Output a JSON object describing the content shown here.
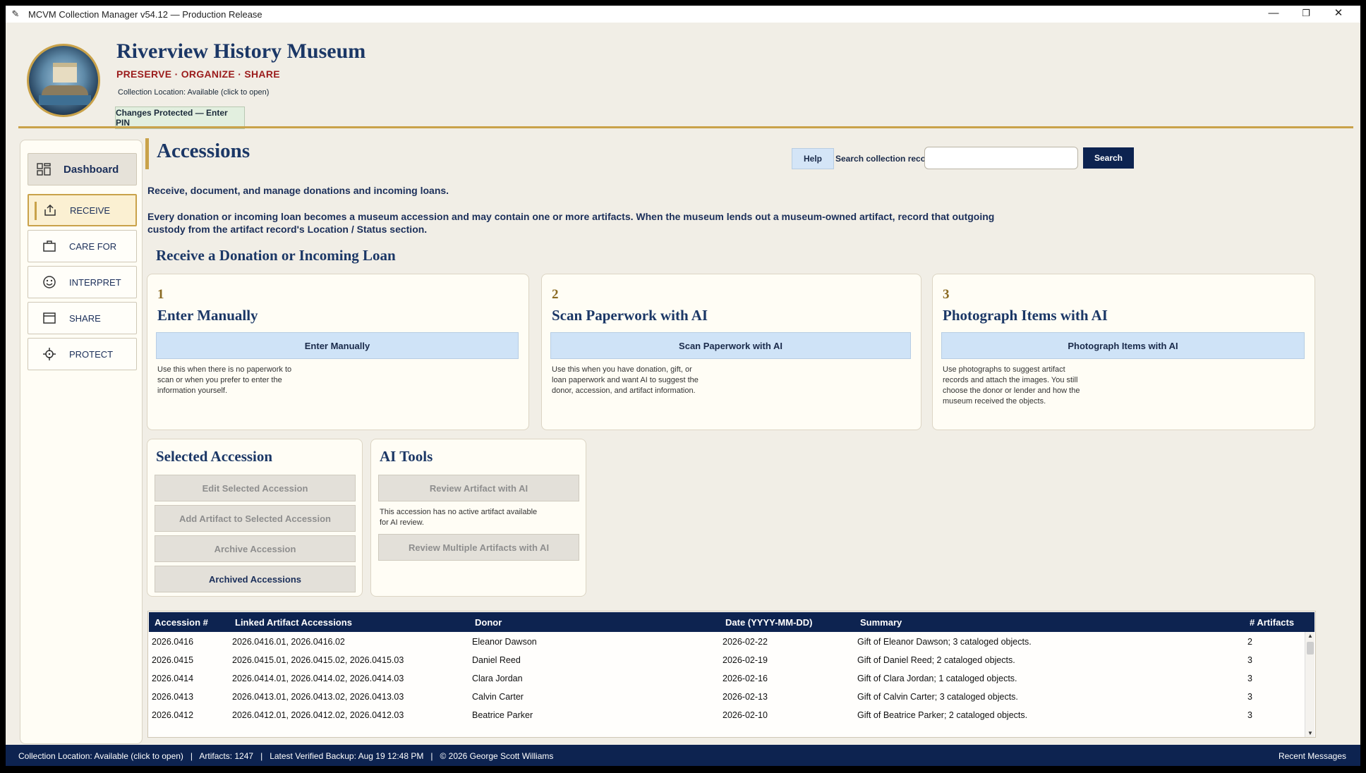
{
  "window": {
    "title": "MCVM Collection Manager v54.12 — Production Release",
    "app_icon": "feather-icon",
    "minimize": "—",
    "restore": "❐",
    "close": "✕"
  },
  "header": {
    "museum_name": "Riverview History Museum",
    "tagline": "PRESERVE · ORGANIZE · SHARE",
    "location": "Collection Location: Available (click to open)",
    "pin_button": "Changes Protected — Enter PIN"
  },
  "sidebar": {
    "dashboard": "Dashboard",
    "items": [
      {
        "label": "RECEIVE",
        "icon": "inbox-upload-icon"
      },
      {
        "label": "CARE FOR",
        "icon": "briefcase-icon"
      },
      {
        "label": "INTERPRET",
        "icon": "smiley-icon"
      },
      {
        "label": "SHARE",
        "icon": "window-icon"
      },
      {
        "label": "PROTECT",
        "icon": "crosshair-icon"
      }
    ]
  },
  "page": {
    "title": "Accessions",
    "help_label": "Help",
    "search_label": "Search collection records",
    "search_placeholder": "",
    "search_value": "",
    "search_button": "Search",
    "subtitle": "Receive, document, and manage donations and incoming loans.",
    "intro": "Every donation or incoming loan becomes a museum accession and may contain one or more artifacts. When the museum lends out a museum-owned artifact, record that outgoing custody from the artifact record's Location / Status section.",
    "receive_heading": "Receive a Donation or Incoming Loan"
  },
  "cards": [
    {
      "number": "1",
      "title": "Enter Manually",
      "button": "Enter Manually",
      "description": "Use this when there is no paperwork to scan or when you prefer to enter the information yourself."
    },
    {
      "number": "2",
      "title": "Scan Paperwork with AI",
      "button": "Scan Paperwork with AI",
      "description": "Use this when you have donation, gift, or loan paperwork and want AI to suggest the donor, accession, and artifact information."
    },
    {
      "number": "3",
      "title": "Photograph Items with AI",
      "button": "Photograph Items with AI",
      "description": "Use photographs to suggest artifact records and attach the images. You still choose the donor or lender and how the museum received the objects."
    }
  ],
  "selected_accession": {
    "title": "Selected Accession",
    "edit": "Edit Selected Accession",
    "add_artifact": "Add Artifact to Selected Accession",
    "archive": "Archive Accession",
    "archived": "Archived Accessions"
  },
  "ai_tools": {
    "title": "AI Tools",
    "review": "Review Artifact with AI",
    "note": "This accession has no active artifact available for AI review.",
    "review_multiple": "Review Multiple Artifacts with AI"
  },
  "table": {
    "columns": [
      "Accession #",
      "Linked Artifact Accessions",
      "Donor",
      "Date (YYYY-MM-DD)",
      "Summary",
      "# Artifacts"
    ],
    "rows": [
      [
        "2026.0416",
        "2026.0416.01, 2026.0416.02",
        "Eleanor Dawson",
        "2026-02-22",
        "Gift of Eleanor Dawson; 3 cataloged objects.",
        "2"
      ],
      [
        "2026.0415",
        "2026.0415.01, 2026.0415.02, 2026.0415.03",
        "Daniel Reed",
        "2026-02-19",
        "Gift of Daniel Reed; 2 cataloged objects.",
        "3"
      ],
      [
        "2026.0414",
        "2026.0414.01, 2026.0414.02, 2026.0414.03",
        "Clara Jordan",
        "2026-02-16",
        "Gift of Clara Jordan; 1 cataloged objects.",
        "3"
      ],
      [
        "2026.0413",
        "2026.0413.01, 2026.0413.02, 2026.0413.03",
        "Calvin Carter",
        "2026-02-13",
        "Gift of Calvin Carter; 3 cataloged objects.",
        "3"
      ],
      [
        "2026.0412",
        "2026.0412.01, 2026.0412.02, 2026.0412.03",
        "Beatrice Parker",
        "2026-02-10",
        "Gift of Beatrice Parker; 2 cataloged objects.",
        "3"
      ]
    ]
  },
  "statusbar": {
    "text": "Collection Location: Available (click to open)   |   Artifacts: 1247   |   Latest Verified Backup: Aug 19 12:48 PM   |   © 2026 George Scott Williams",
    "recent_messages": "Recent Messages"
  },
  "colors": {
    "navy": "#0d2350",
    "gold": "#c9a24a",
    "title_blue": "#1b3766",
    "tagline_red": "#9b1c1c",
    "card_button": "#cfe3f7",
    "disabled_button": "#e3e0d9"
  }
}
